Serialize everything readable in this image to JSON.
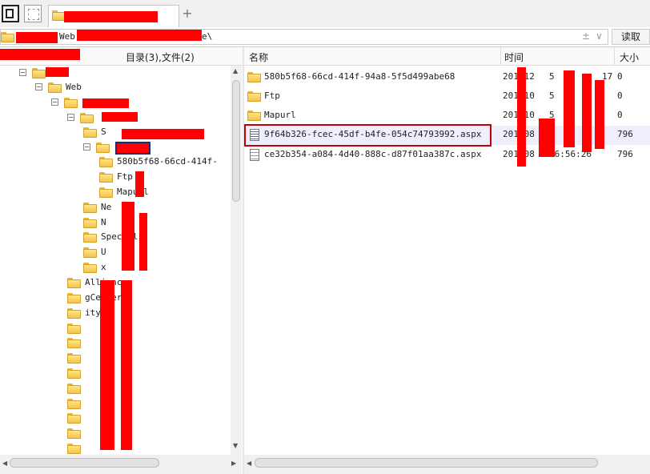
{
  "toolbar": {
    "add_tab": "+"
  },
  "address": {
    "visible_text_a": "Web",
    "visible_text_b": "e\\",
    "history_glyph": "±",
    "dropdown_glyph": "∨",
    "read_button": "读取"
  },
  "tree_header": {
    "summary": "目录(3),文件(2)"
  },
  "list_header": {
    "name": "名称",
    "time": "时间",
    "size": "大小"
  },
  "tree": [
    {
      "label": "",
      "indent": 0,
      "toggle": "−"
    },
    {
      "label": "Web",
      "indent": 1,
      "toggle": "−"
    },
    {
      "label": "",
      "indent": 2,
      "toggle": "−"
    },
    {
      "label": "",
      "indent": 3,
      "toggle": "−"
    },
    {
      "label": "S",
      "indent": 4,
      "toggle": ""
    },
    {
      "label": "",
      "indent": 4,
      "toggle": "−"
    },
    {
      "label": "580b5f68-66cd-414f-",
      "indent": 5,
      "toggle": ""
    },
    {
      "label": "Ftp",
      "indent": 5,
      "toggle": ""
    },
    {
      "label": "Mapurl",
      "indent": 5,
      "toggle": ""
    },
    {
      "label": "Ne",
      "indent": 4,
      "toggle": ""
    },
    {
      "label": "N",
      "indent": 4,
      "toggle": ""
    },
    {
      "label": "Special",
      "indent": 4,
      "toggle": ""
    },
    {
      "label": "U",
      "indent": 4,
      "toggle": ""
    },
    {
      "label": "x",
      "indent": 4,
      "toggle": ""
    },
    {
      "label": "Alliance",
      "indent": 3,
      "toggle": ""
    },
    {
      "label": "gCenter",
      "indent": 3,
      "toggle": ""
    },
    {
      "label": "ity",
      "indent": 3,
      "toggle": ""
    },
    {
      "label": "",
      "indent": 3,
      "toggle": ""
    },
    {
      "label": "",
      "indent": 3,
      "toggle": ""
    },
    {
      "label": "",
      "indent": 3,
      "toggle": ""
    },
    {
      "label": "",
      "indent": 3,
      "toggle": ""
    },
    {
      "label": "",
      "indent": 3,
      "toggle": ""
    },
    {
      "label": "",
      "indent": 3,
      "toggle": ""
    },
    {
      "label": "",
      "indent": 3,
      "toggle": ""
    },
    {
      "label": "",
      "indent": 3,
      "toggle": ""
    },
    {
      "label": "",
      "indent": 3,
      "toggle": ""
    }
  ],
  "files": [
    {
      "name": "580b5f68-66cd-414f-94a8-5f5d499abe68",
      "time_a": "201",
      "time_b": "-12",
      "time_c": "5",
      "time_d": "17",
      "size": "0",
      "type": "folder",
      "selected": false
    },
    {
      "name": "Ftp",
      "time_a": "201",
      "time_b": "-10",
      "time_c": "5",
      "time_d": "",
      "size": "0",
      "type": "folder",
      "selected": false
    },
    {
      "name": "Mapurl",
      "time_a": "201",
      "time_b": "-10",
      "time_c": "5",
      "time_d": "",
      "size": "0",
      "type": "folder",
      "selected": false
    },
    {
      "name": "9f64b326-fcec-45df-b4fe-054c74793992.aspx",
      "time_a": "201",
      "time_b": "-08",
      "time_c": "",
      "time_d": "",
      "size": "796",
      "type": "aspx",
      "selected": true
    },
    {
      "name": "ce32b354-a084-4d40-888c-d87f01aa387c.aspx",
      "time_a": "201",
      "time_b": "-08",
      "time_c": "16:56:26",
      "time_d": "",
      "size": "796",
      "type": "txt",
      "selected": false
    }
  ],
  "colors": {
    "redaction": "#ff0000",
    "highlight_box": "#c00000",
    "selected_row": "#eeeefc",
    "folder": "#f2c44a"
  },
  "icons": [
    "panel-icon",
    "tab-page-icon",
    "folder-icon",
    "aspx-file-icon",
    "text-file-icon",
    "add-tab-icon"
  ]
}
